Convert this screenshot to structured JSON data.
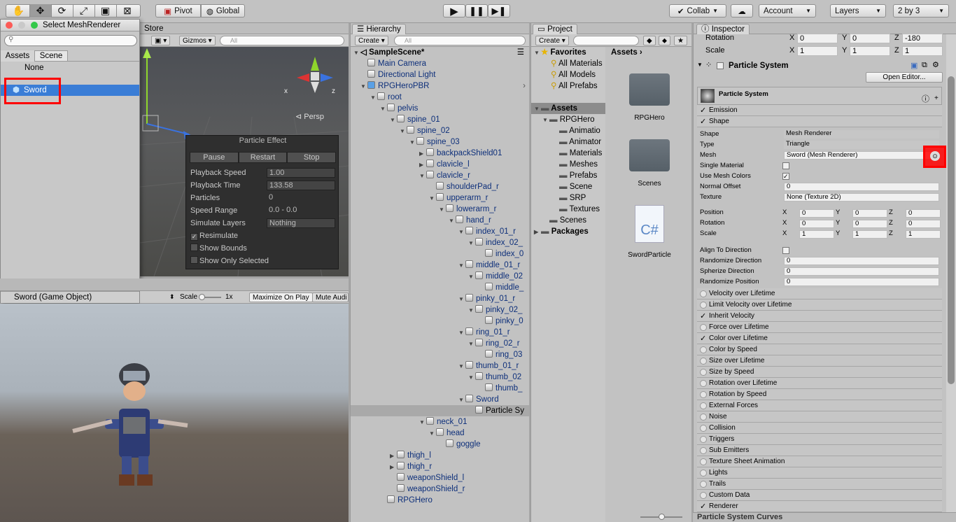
{
  "toolbar": {
    "pivot": "Pivot",
    "global": "Global",
    "collab": "Collab",
    "account": "Account",
    "layers": "Layers",
    "layout": "2 by 3"
  },
  "tabs": {
    "store": "Store",
    "hierarchy": "Hierarchy",
    "project": "Project",
    "inspector": "Inspector"
  },
  "select_dialog": {
    "title": "Select MeshRenderer",
    "tab_assets": "Assets",
    "tab_scene": "Scene",
    "items": [
      "None",
      "Sword"
    ],
    "footer": "Sword (Game Object)"
  },
  "scene": {
    "gizmos": "Gizmos",
    "search_placeholder": "All",
    "persp": "Persp",
    "axis_x": "x",
    "axis_z": "z"
  },
  "particle_effect": {
    "title": "Particle Effect",
    "pause": "Pause",
    "restart": "Restart",
    "stop": "Stop",
    "rows": [
      {
        "label": "Playback Speed",
        "value": "1.00"
      },
      {
        "label": "Playback Time",
        "value": "133.58"
      },
      {
        "label": "Particles",
        "value": "0"
      },
      {
        "label": "Speed Range",
        "value": "0.0 - 0.0"
      },
      {
        "label": "Simulate Layers",
        "value": "Nothing"
      }
    ],
    "checks": [
      "Resimulate",
      "Show Bounds",
      "Show Only Selected"
    ]
  },
  "game": {
    "scale": "Scale",
    "scale_val": "1x",
    "maximize": "Maximize On Play",
    "mute": "Mute Audi"
  },
  "hierarchy": {
    "create": "Create",
    "search_placeholder": "All",
    "scene": "SampleScene*",
    "rows": [
      {
        "t": "Main Camera",
        "d": 1,
        "a": ""
      },
      {
        "t": "Directional Light",
        "d": 1,
        "a": ""
      },
      {
        "t": "RPGHeroPBR",
        "d": 1,
        "a": "open",
        "blue": true
      },
      {
        "t": "root",
        "d": 2,
        "a": "open"
      },
      {
        "t": "pelvis",
        "d": 3,
        "a": "open"
      },
      {
        "t": "spine_01",
        "d": 4,
        "a": "open"
      },
      {
        "t": "spine_02",
        "d": 5,
        "a": "open"
      },
      {
        "t": "spine_03",
        "d": 6,
        "a": "open"
      },
      {
        "t": "backpackShield01",
        "d": 7,
        "a": "closed"
      },
      {
        "t": "clavicle_l",
        "d": 7,
        "a": "closed"
      },
      {
        "t": "clavicle_r",
        "d": 7,
        "a": "open"
      },
      {
        "t": "shoulderPad_r",
        "d": 8,
        "a": ""
      },
      {
        "t": "upperarm_r",
        "d": 8,
        "a": "open"
      },
      {
        "t": "lowerarm_r",
        "d": 9,
        "a": "open"
      },
      {
        "t": "hand_r",
        "d": 10,
        "a": "open"
      },
      {
        "t": "index_01_r",
        "d": 11,
        "a": "open"
      },
      {
        "t": "index_02_",
        "d": 12,
        "a": "open"
      },
      {
        "t": "index_0",
        "d": 13,
        "a": ""
      },
      {
        "t": "middle_01_r",
        "d": 11,
        "a": "open"
      },
      {
        "t": "middle_02",
        "d": 12,
        "a": "open"
      },
      {
        "t": "middle_",
        "d": 13,
        "a": ""
      },
      {
        "t": "pinky_01_r",
        "d": 11,
        "a": "open"
      },
      {
        "t": "pinky_02_",
        "d": 12,
        "a": "open"
      },
      {
        "t": "pinky_0",
        "d": 13,
        "a": ""
      },
      {
        "t": "ring_01_r",
        "d": 11,
        "a": "open"
      },
      {
        "t": "ring_02_r",
        "d": 12,
        "a": "open"
      },
      {
        "t": "ring_03",
        "d": 13,
        "a": ""
      },
      {
        "t": "thumb_01_r",
        "d": 11,
        "a": "open"
      },
      {
        "t": "thumb_02",
        "d": 12,
        "a": "open"
      },
      {
        "t": "thumb_",
        "d": 13,
        "a": ""
      },
      {
        "t": "Sword",
        "d": 11,
        "a": "open"
      },
      {
        "t": "Particle Sy",
        "d": 12,
        "a": "",
        "sel": true
      },
      {
        "t": "neck_01",
        "d": 7,
        "a": "open"
      },
      {
        "t": "head",
        "d": 8,
        "a": "open"
      },
      {
        "t": "goggle",
        "d": 9,
        "a": ""
      },
      {
        "t": "thigh_l",
        "d": 4,
        "a": "closed"
      },
      {
        "t": "thigh_r",
        "d": 4,
        "a": "closed"
      },
      {
        "t": "weaponShield_l",
        "d": 4,
        "a": ""
      },
      {
        "t": "weaponShield_r",
        "d": 4,
        "a": ""
      },
      {
        "t": "RPGHero",
        "d": 3,
        "a": ""
      }
    ]
  },
  "project": {
    "create": "Create",
    "favorites": "Favorites",
    "fav_items": [
      "All Materials",
      "All Models",
      "All Prefabs"
    ],
    "assets": "Assets",
    "tree": [
      {
        "t": "RPGHero",
        "d": 1
      },
      {
        "t": "Animatio",
        "d": 2
      },
      {
        "t": "Animator",
        "d": 2
      },
      {
        "t": "Materials",
        "d": 2
      },
      {
        "t": "Meshes",
        "d": 2
      },
      {
        "t": "Prefabs",
        "d": 2
      },
      {
        "t": "Scene",
        "d": 2
      },
      {
        "t": "SRP",
        "d": 2
      },
      {
        "t": "Textures",
        "d": 2
      },
      {
        "t": "Scenes",
        "d": 1
      }
    ],
    "packages": "Packages",
    "breadcrumb": "Assets",
    "grid": [
      {
        "name": "RPGHero",
        "kind": "folder"
      },
      {
        "name": "Scenes",
        "kind": "folder"
      },
      {
        "name": "SwordParticle",
        "kind": "script",
        "glyph": "C#"
      }
    ]
  },
  "inspector": {
    "rotation": {
      "label": "Rotation",
      "x": "0",
      "y": "0",
      "z": "-180"
    },
    "scale": {
      "label": "Scale",
      "x": "1",
      "y": "1",
      "z": "1"
    },
    "component": "Particle System",
    "open_editor": "Open Editor...",
    "ps_title": "Particle System",
    "emission": "Emission",
    "shape": "Shape",
    "fields": [
      {
        "label": "Shape",
        "value": "Mesh Renderer"
      },
      {
        "label": "Type",
        "value": "Triangle"
      },
      {
        "label": "Mesh",
        "value": "Sword (Mesh Renderer)"
      },
      {
        "label": "Single Material",
        "value": ""
      },
      {
        "label": "Use Mesh Colors",
        "value": "✓"
      },
      {
        "label": "Normal Offset",
        "value": "0"
      },
      {
        "label": "Texture",
        "value": "None (Texture 2D)"
      }
    ],
    "transform": [
      {
        "label": "Position",
        "x": "0",
        "y": "0",
        "z": "0"
      },
      {
        "label": "Rotation",
        "x": "0",
        "y": "0",
        "z": "0"
      },
      {
        "label": "Scale",
        "x": "1",
        "y": "1",
        "z": "1"
      }
    ],
    "fields2": [
      {
        "label": "Align To Direction",
        "value": ""
      },
      {
        "label": "Randomize Direction",
        "value": "0"
      },
      {
        "label": "Spherize Direction",
        "value": "0"
      },
      {
        "label": "Randomize Position",
        "value": "0"
      }
    ],
    "modules": [
      {
        "t": "Velocity over Lifetime",
        "on": false
      },
      {
        "t": "Limit Velocity over Lifetime",
        "on": false
      },
      {
        "t": "Inherit Velocity",
        "on": true
      },
      {
        "t": "Force over Lifetime",
        "on": false
      },
      {
        "t": "Color over Lifetime",
        "on": true
      },
      {
        "t": "Color by Speed",
        "on": false
      },
      {
        "t": "Size over Lifetime",
        "on": false
      },
      {
        "t": "Size by Speed",
        "on": false
      },
      {
        "t": "Rotation over Lifetime",
        "on": false
      },
      {
        "t": "Rotation by Speed",
        "on": false
      },
      {
        "t": "External Forces",
        "on": false
      },
      {
        "t": "Noise",
        "on": false
      },
      {
        "t": "Collision",
        "on": false
      },
      {
        "t": "Triggers",
        "on": false
      },
      {
        "t": "Sub Emitters",
        "on": false
      },
      {
        "t": "Texture Sheet Animation",
        "on": false
      },
      {
        "t": "Lights",
        "on": false
      },
      {
        "t": "Trails",
        "on": false
      },
      {
        "t": "Custom Data",
        "on": false
      },
      {
        "t": "Renderer",
        "on": true
      }
    ],
    "curves": "Particle System Curves"
  }
}
